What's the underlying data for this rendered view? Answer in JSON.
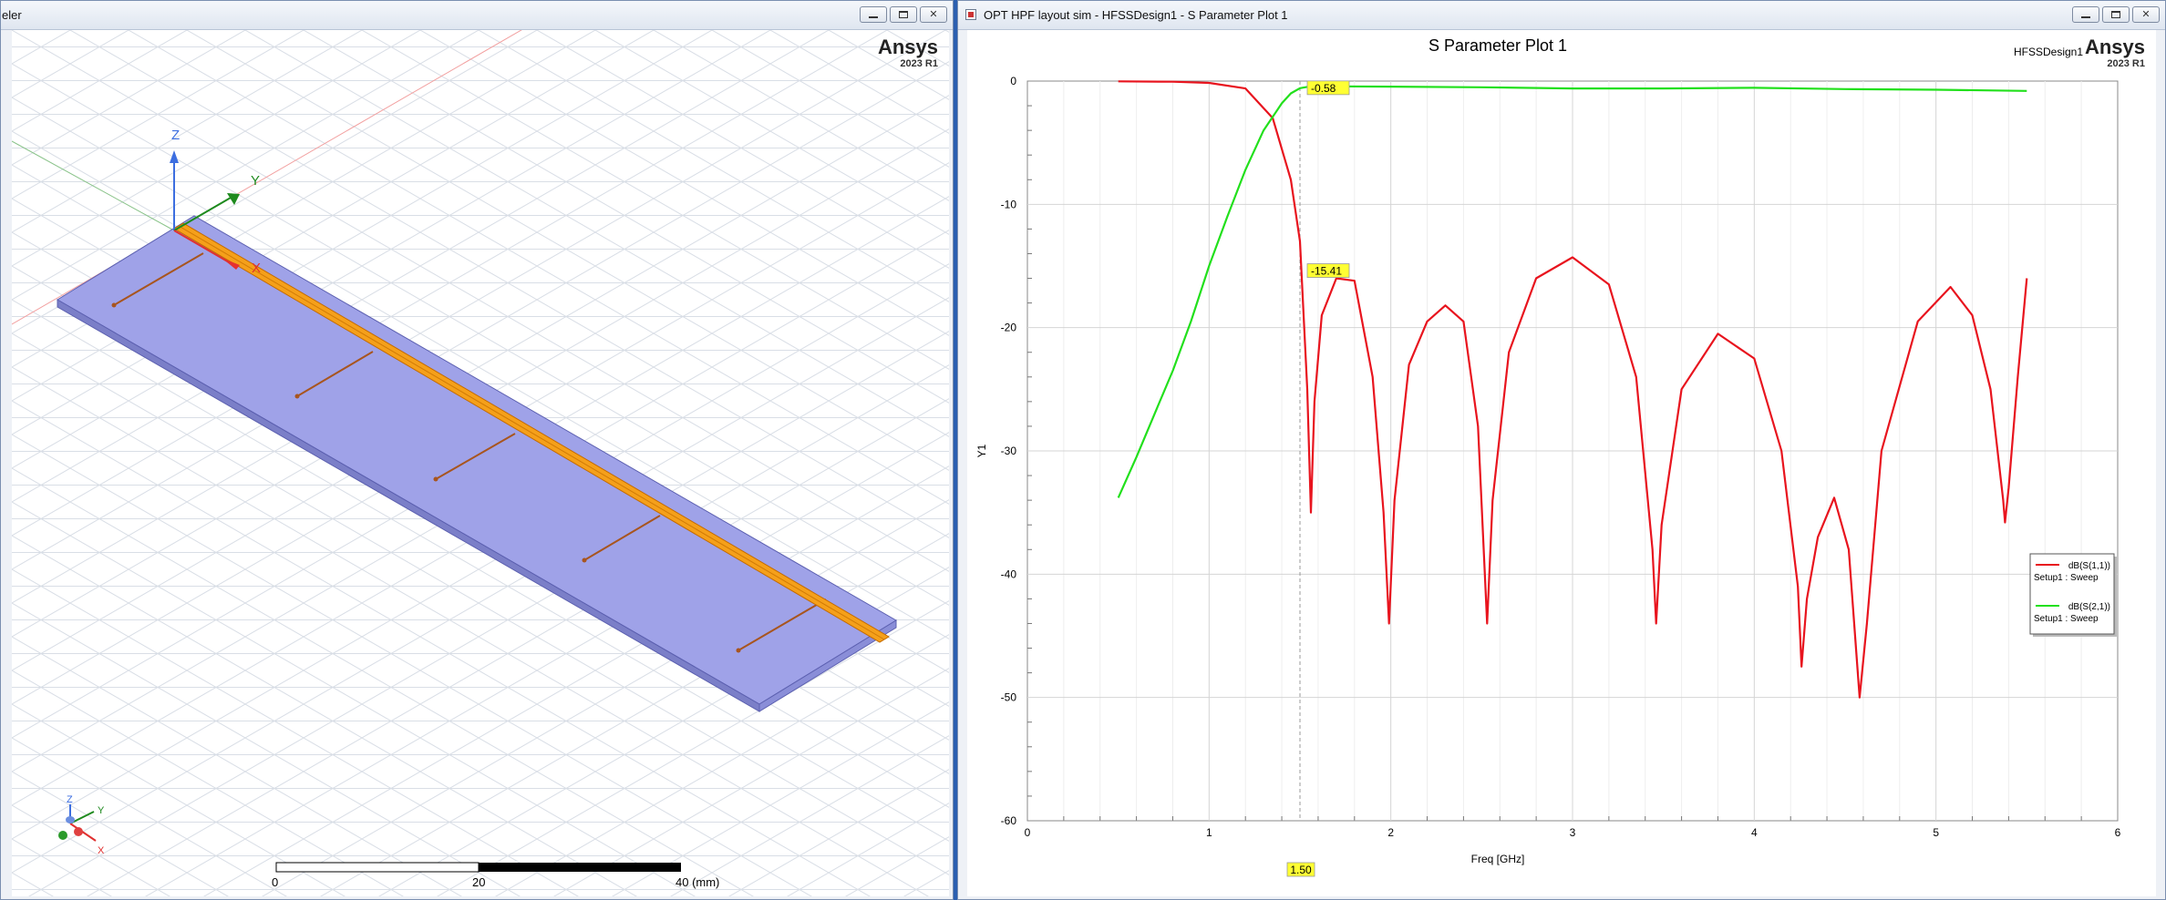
{
  "left_window": {
    "title": "eler",
    "brand": {
      "name": "Ansys",
      "version": "2023 R1"
    },
    "axes": {
      "z": "Z",
      "y": "Y",
      "x": "X"
    },
    "mini_axes": {
      "z": "Z",
      "y": "Y",
      "x": "X"
    },
    "scale_bar": {
      "labels": [
        "0",
        "20",
        "40 (mm)"
      ]
    }
  },
  "right_window": {
    "title": "OPT HPF layout sim - HFSSDesign1 - S Parameter Plot 1",
    "brand": {
      "name": "Ansys",
      "version": "2023 R1"
    },
    "design_label": "HFSSDesign1",
    "colors": {
      "s11": "#e8141e",
      "s21": "#22e01c",
      "marker_fill": "#ffff33"
    }
  },
  "chart_data": {
    "type": "line",
    "title": "S Parameter Plot 1",
    "xlabel": "Freq [GHz]",
    "ylabel": "Y1",
    "xlim": [
      0,
      6
    ],
    "ylim": [
      -60,
      0
    ],
    "x_ticks": [
      "0",
      "1",
      "2",
      "3",
      "4",
      "5",
      "6"
    ],
    "y_ticks": [
      "0",
      "-10",
      "-20",
      "-30",
      "-40",
      "-50",
      "-60"
    ],
    "grid": true,
    "legend_position": "right",
    "series": [
      {
        "name": "dB(S(1,1))",
        "legend_sub": "Setup1 : Sweep",
        "color": "#e8141e",
        "x": [
          0.5,
          0.8,
          1.0,
          1.2,
          1.35,
          1.45,
          1.5,
          1.54,
          1.56,
          1.58,
          1.62,
          1.7,
          1.8,
          1.9,
          1.96,
          1.99,
          2.02,
          2.1,
          2.2,
          2.3,
          2.4,
          2.48,
          2.53,
          2.56,
          2.65,
          2.8,
          3.0,
          3.2,
          3.35,
          3.44,
          3.46,
          3.49,
          3.6,
          3.8,
          4.0,
          4.15,
          4.24,
          4.26,
          4.29,
          4.35,
          4.44,
          4.52,
          4.58,
          4.62,
          4.7,
          4.9,
          5.08,
          5.2,
          5.3,
          5.37,
          5.38,
          5.4,
          5.45,
          5.5
        ],
        "y": [
          -0.02,
          -0.05,
          -0.15,
          -0.6,
          -3.0,
          -8.0,
          -13.0,
          -25.0,
          -35.0,
          -26.0,
          -19.0,
          -16.0,
          -16.2,
          -24.0,
          -35.0,
          -44.0,
          -34.0,
          -23.0,
          -19.5,
          -18.2,
          -19.5,
          -28.0,
          -44.0,
          -34.0,
          -22.0,
          -16.0,
          -14.3,
          -16.5,
          -24.0,
          -38.0,
          -44.0,
          -36.0,
          -25.0,
          -20.5,
          -22.5,
          -30.0,
          -41.0,
          -47.5,
          -42.0,
          -37.0,
          -33.8,
          -38.0,
          -50.0,
          -44.0,
          -30.0,
          -19.5,
          -16.7,
          -19.0,
          -25.0,
          -34.0,
          -35.8,
          -33.0,
          -24.0,
          -16.0
        ]
      },
      {
        "name": "dB(S(2,1))",
        "legend_sub": "Setup1 : Sweep",
        "color": "#22e01c",
        "x": [
          0.5,
          0.6,
          0.7,
          0.8,
          0.9,
          1.0,
          1.1,
          1.2,
          1.3,
          1.4,
          1.45,
          1.5,
          1.55,
          1.6,
          2.0,
          2.5,
          3.0,
          3.5,
          4.0,
          4.5,
          5.0,
          5.5
        ],
        "y": [
          -33.8,
          -30.5,
          -27.0,
          -23.5,
          -19.5,
          -15.0,
          -11.0,
          -7.2,
          -4.0,
          -1.8,
          -1.0,
          -0.58,
          -0.45,
          -0.42,
          -0.45,
          -0.5,
          -0.6,
          -0.6,
          -0.55,
          -0.65,
          -0.7,
          -0.8
        ]
      }
    ],
    "markers": [
      {
        "x": 1.5,
        "y": -0.58,
        "label": "-0.58"
      },
      {
        "x": 1.5,
        "y": -15.41,
        "label": "-15.41"
      }
    ],
    "cursor": {
      "x": 1.5,
      "label": "1.50"
    }
  }
}
